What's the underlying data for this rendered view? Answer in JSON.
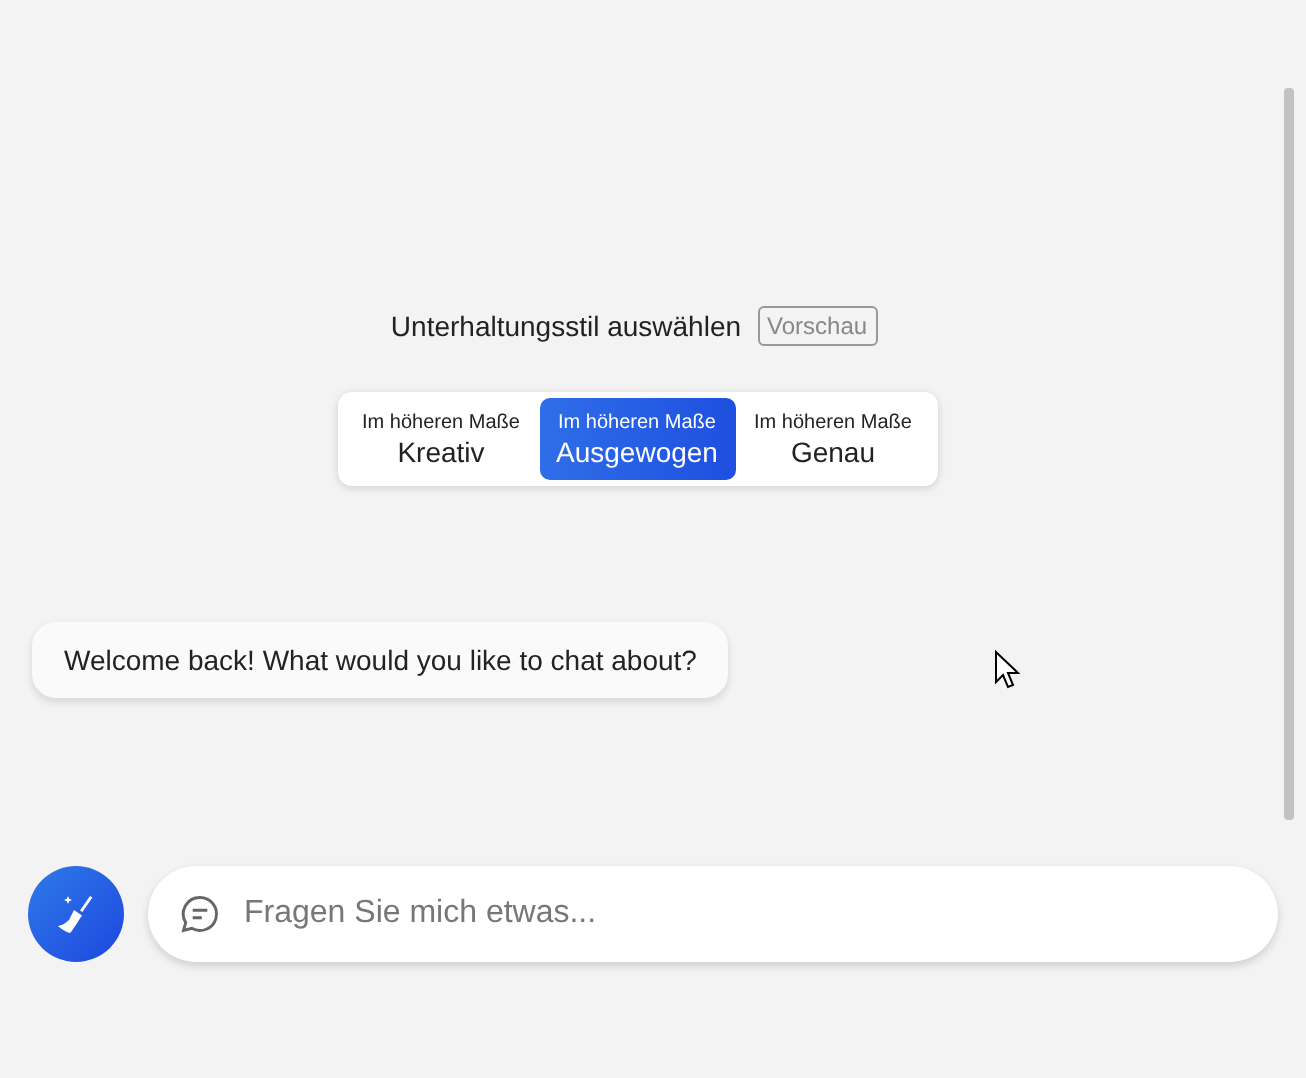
{
  "style_picker": {
    "title": "Unterhaltungsstil auswählen",
    "preview_badge": "Vorschau",
    "options": [
      {
        "prefix": "Im höheren Maße",
        "label": "Kreativ",
        "selected": false
      },
      {
        "prefix": "Im höheren Maße",
        "label": "Ausgewogen",
        "selected": true
      },
      {
        "prefix": "Im höheren Maße",
        "label": "Genau",
        "selected": false
      }
    ]
  },
  "messages": [
    {
      "text": "Welcome back! What would you like to chat about?"
    }
  ],
  "composer": {
    "placeholder": "Fragen Sie mich etwas..."
  }
}
